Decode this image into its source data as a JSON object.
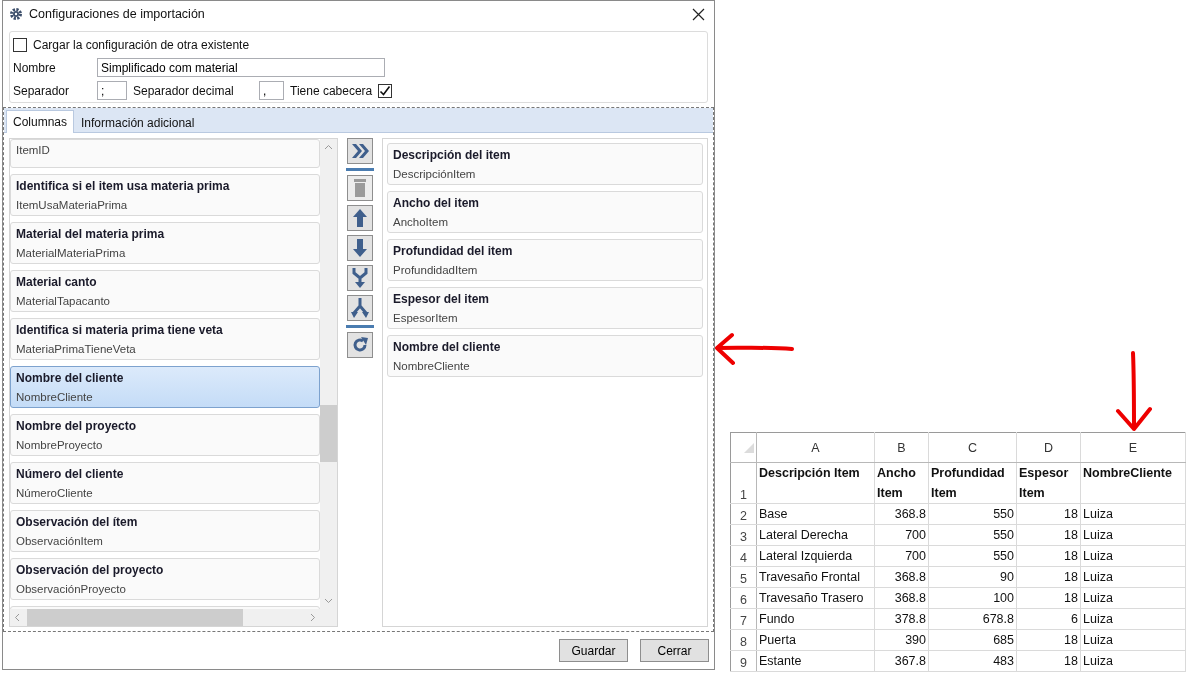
{
  "window": {
    "title": "Configuraciones de importación"
  },
  "load_existing": {
    "label": "Cargar la configuración de otra existente",
    "checked": false
  },
  "name_field": {
    "label": "Nombre",
    "value": "Simplificado com material"
  },
  "separator_field": {
    "label": "Separador",
    "value": ";"
  },
  "decimal_field": {
    "label": "Separador decimal",
    "value": ","
  },
  "has_header": {
    "label": "Tiene cabecera",
    "checked": true
  },
  "tabs": [
    {
      "label": "Columnas",
      "selected": true
    },
    {
      "label": "Información adicional",
      "selected": false
    }
  ],
  "available_columns": [
    {
      "code": "ItemID",
      "selected": false
    },
    {
      "title": "Identifica si el item usa materia prima",
      "code": "ItemUsaMateriaPrima",
      "selected": false
    },
    {
      "title": "Material del materia prima",
      "code": "MaterialMateriaPrima",
      "selected": false
    },
    {
      "title": "Material canto",
      "code": "MaterialTapacanto",
      "selected": false
    },
    {
      "title": "Identifica si materia prima tiene veta",
      "code": "MateriaPrimaTieneVeta",
      "selected": false
    },
    {
      "title": "Nombre del cliente",
      "code": "NombreCliente",
      "selected": true
    },
    {
      "title": "Nombre del proyecto",
      "code": "NombreProyecto",
      "selected": false
    },
    {
      "title": "Número del cliente",
      "code": "NúmeroCliente",
      "selected": false
    },
    {
      "title": "Observación del ítem",
      "code": "ObservaciónItem",
      "selected": false
    },
    {
      "title": "Observación del proyecto",
      "code": "ObservaciónProyecto",
      "selected": false
    },
    {
      "selected": false
    }
  ],
  "tools": [
    {
      "kind": "add_all",
      "disabled": false
    },
    {
      "kind": "separator"
    },
    {
      "kind": "delete",
      "disabled": true
    },
    {
      "kind": "up",
      "disabled": false
    },
    {
      "kind": "down",
      "disabled": false
    },
    {
      "kind": "merge",
      "disabled": false
    },
    {
      "kind": "split",
      "disabled": false
    },
    {
      "kind": "separator"
    },
    {
      "kind": "refresh",
      "disabled": false
    }
  ],
  "chosen_columns": [
    {
      "title": "Descripción del item",
      "code": "DescripciónItem"
    },
    {
      "title": "Ancho del item",
      "code": "AnchoItem"
    },
    {
      "title": "Profundidad del item",
      "code": "ProfundidadItem"
    },
    {
      "title": "Espesor del item",
      "code": "EspesorItem"
    },
    {
      "title": "Nombre del cliente",
      "code": "NombreCliente"
    }
  ],
  "buttons": [
    "Guardar",
    "Cerrar"
  ],
  "spreadsheet": {
    "columns": [
      {
        "letter": "A",
        "numeric": false
      },
      {
        "letter": "B",
        "numeric": true
      },
      {
        "letter": "C",
        "numeric": true
      },
      {
        "letter": "D",
        "numeric": true
      },
      {
        "letter": "E",
        "numeric": false
      }
    ],
    "rows": [
      {
        "number": "1",
        "header": true,
        "cells": [
          "Descripción Item",
          "Ancho Item",
          "Profundidad Item",
          "Espesor Item",
          "NombreCliente"
        ]
      },
      {
        "number": "2",
        "header": false,
        "cells": [
          "Base",
          "368.8",
          "550",
          "18",
          "Luiza"
        ]
      },
      {
        "number": "3",
        "header": false,
        "cells": [
          "Lateral Derecha",
          "700",
          "550",
          "18",
          "Luiza"
        ]
      },
      {
        "number": "4",
        "header": false,
        "cells": [
          "Lateral Izquierda",
          "700",
          "550",
          "18",
          "Luiza"
        ]
      },
      {
        "number": "5",
        "header": false,
        "cells": [
          "Travesaño Frontal",
          "368.8",
          "90",
          "18",
          "Luiza"
        ]
      },
      {
        "number": "6",
        "header": false,
        "cells": [
          "Travesaño Trasero",
          "368.8",
          "100",
          "18",
          "Luiza"
        ]
      },
      {
        "number": "7",
        "header": false,
        "cells": [
          "Fundo",
          "378.8",
          "678.8",
          "6",
          "Luiza"
        ]
      },
      {
        "number": "8",
        "header": false,
        "cells": [
          "Puerta",
          "390",
          "685",
          "18",
          "Luiza"
        ]
      },
      {
        "number": "9",
        "header": false,
        "cells": [
          "Estante",
          "367.8",
          "483",
          "18",
          "Luiza"
        ]
      }
    ]
  }
}
